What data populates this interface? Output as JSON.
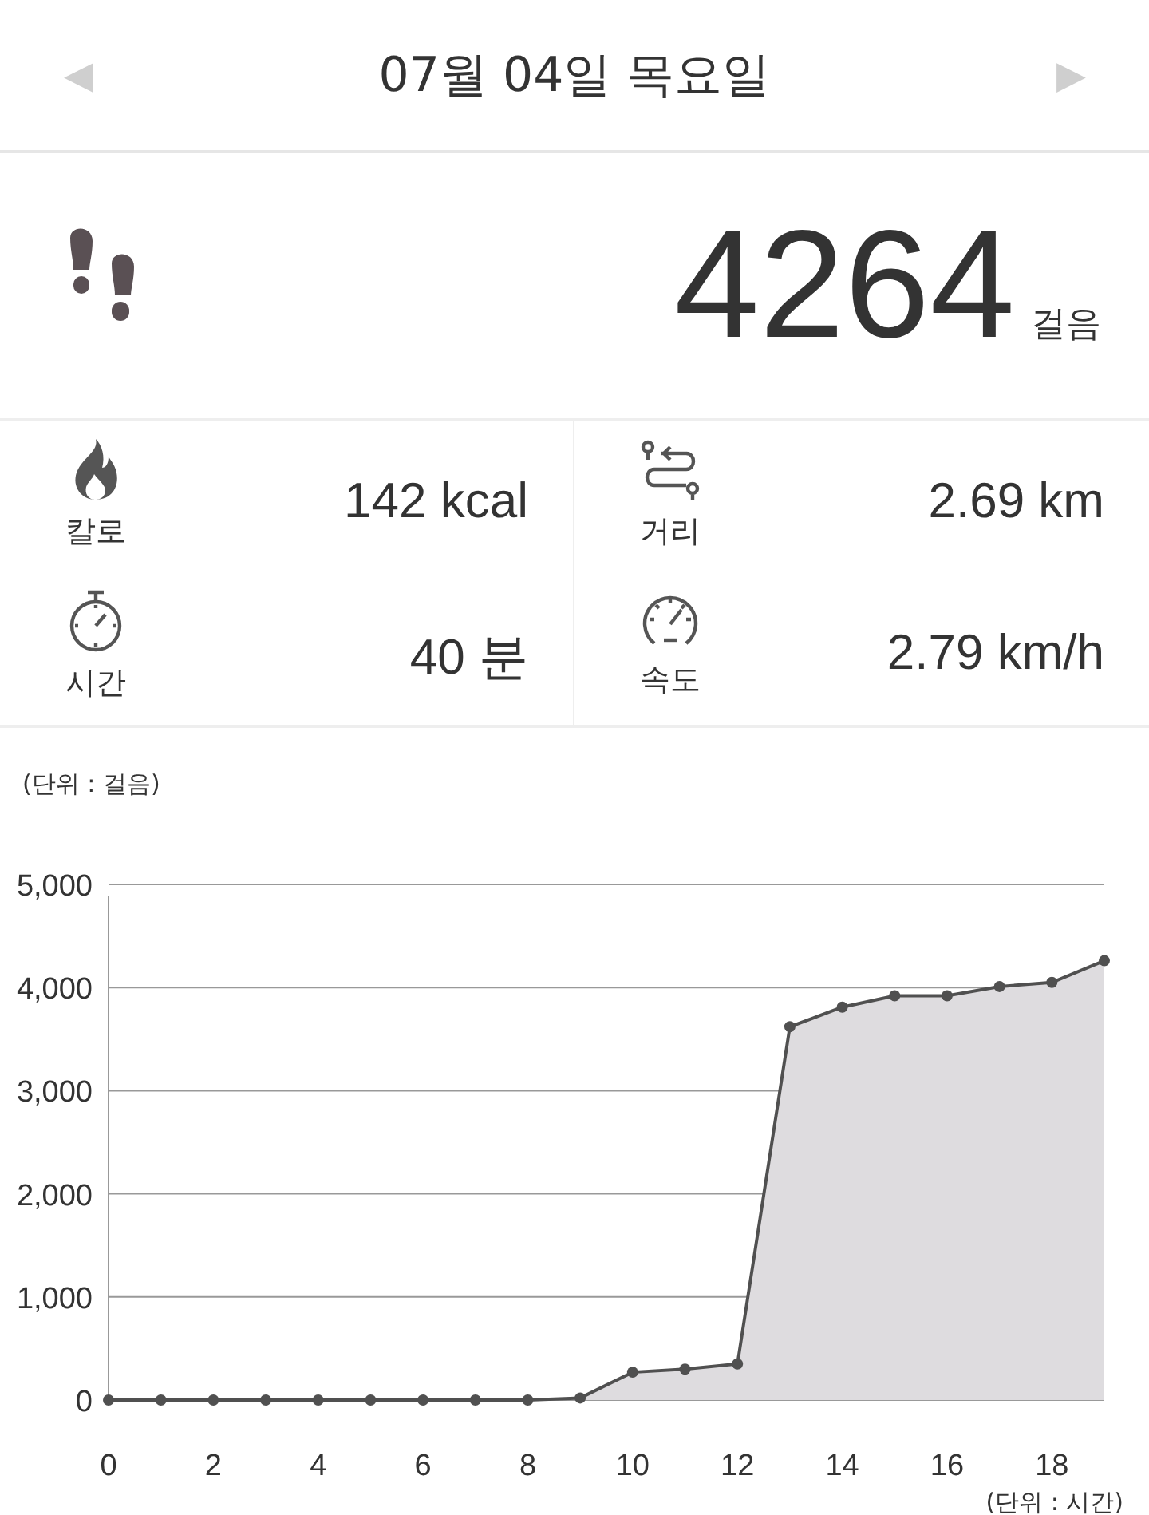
{
  "header": {
    "prev": "◀",
    "title": "07월 04일 목요일",
    "next": "▶"
  },
  "steps": {
    "value": "4264",
    "unit": "걸음"
  },
  "stats": [
    {
      "kind": "calories",
      "label": "칼로",
      "value": "142 kcal"
    },
    {
      "kind": "distance",
      "label": "거리",
      "value": "2.69 km"
    },
    {
      "kind": "time",
      "label": "시간",
      "value": "40 분"
    },
    {
      "kind": "speed",
      "label": "속도",
      "value": "2.79 km/h"
    }
  ],
  "chart": {
    "chart_data": {
      "type": "area",
      "ylabel": "(단위 : 걸음)",
      "xlabel": "(단위 : 시간)",
      "x": [
        0,
        1,
        2,
        3,
        4,
        5,
        6,
        7,
        8,
        9,
        10,
        11,
        12,
        13,
        14,
        15,
        16,
        17,
        18,
        19
      ],
      "series": [
        {
          "color": "#505050",
          "values": [
            0,
            0,
            0,
            0,
            0,
            0,
            0,
            0,
            0,
            20,
            270,
            300,
            350,
            3620,
            3810,
            3920,
            3920,
            4010,
            4050,
            4260
          ]
        }
      ],
      "grid": true,
      "xlim": [
        0,
        19
      ],
      "ylim": [
        0,
        5000
      ],
      "xticks": [
        0,
        2,
        4,
        6,
        8,
        10,
        12,
        14,
        16,
        18
      ],
      "yticks": [
        {
          "value": 0,
          "label": "0"
        },
        {
          "value": 1000,
          "label": "1,000"
        },
        {
          "value": 2000,
          "label": "2,000"
        },
        {
          "value": 3000,
          "label": "3,000"
        },
        {
          "value": 4000,
          "label": "4,000"
        },
        {
          "value": 5000,
          "label": "5,000"
        }
      ]
    }
  }
}
